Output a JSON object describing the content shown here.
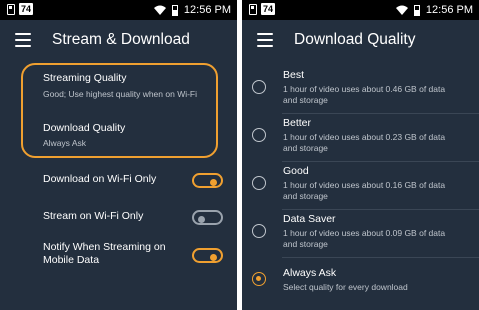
{
  "status_bar": {
    "badge": "74",
    "time": "12:56 PM"
  },
  "left_screen": {
    "title": "Stream & Download",
    "streaming_quality": {
      "label": "Streaming Quality",
      "value": "Good; Use highest quality when on Wi-Fi"
    },
    "download_quality": {
      "label": "Download Quality",
      "value": "Always Ask"
    },
    "toggles": [
      {
        "label": "Download on Wi-Fi Only",
        "state": "on"
      },
      {
        "label": "Stream on Wi-Fi Only",
        "state": "off"
      },
      {
        "label_line1": "Notify When Streaming on",
        "label_line2": "Mobile Data",
        "state": "on"
      }
    ]
  },
  "right_screen": {
    "title": "Download Quality",
    "options": [
      {
        "label": "Best",
        "desc_line1": "1 hour of video uses about 0.46 GB of data",
        "desc_line2": "and storage",
        "selected": false
      },
      {
        "label": "Better",
        "desc_line1": "1 hour of video uses about 0.23 GB of data",
        "desc_line2": "and storage",
        "selected": false
      },
      {
        "label": "Good",
        "desc_line1": "1 hour of video uses about 0.16 GB of data",
        "desc_line2": "and storage",
        "selected": false
      },
      {
        "label": "Data Saver",
        "desc_line1": "1 hour of video uses about 0.09 GB of data",
        "desc_line2": "and storage",
        "selected": false
      },
      {
        "label": "Always Ask",
        "desc_line1": "Select quality for every download",
        "selected": true
      }
    ]
  },
  "colors": {
    "background": "#232f3e",
    "accent": "#f0a030",
    "status_bar": "#000000",
    "toggle_off": "#9aa3ad"
  }
}
